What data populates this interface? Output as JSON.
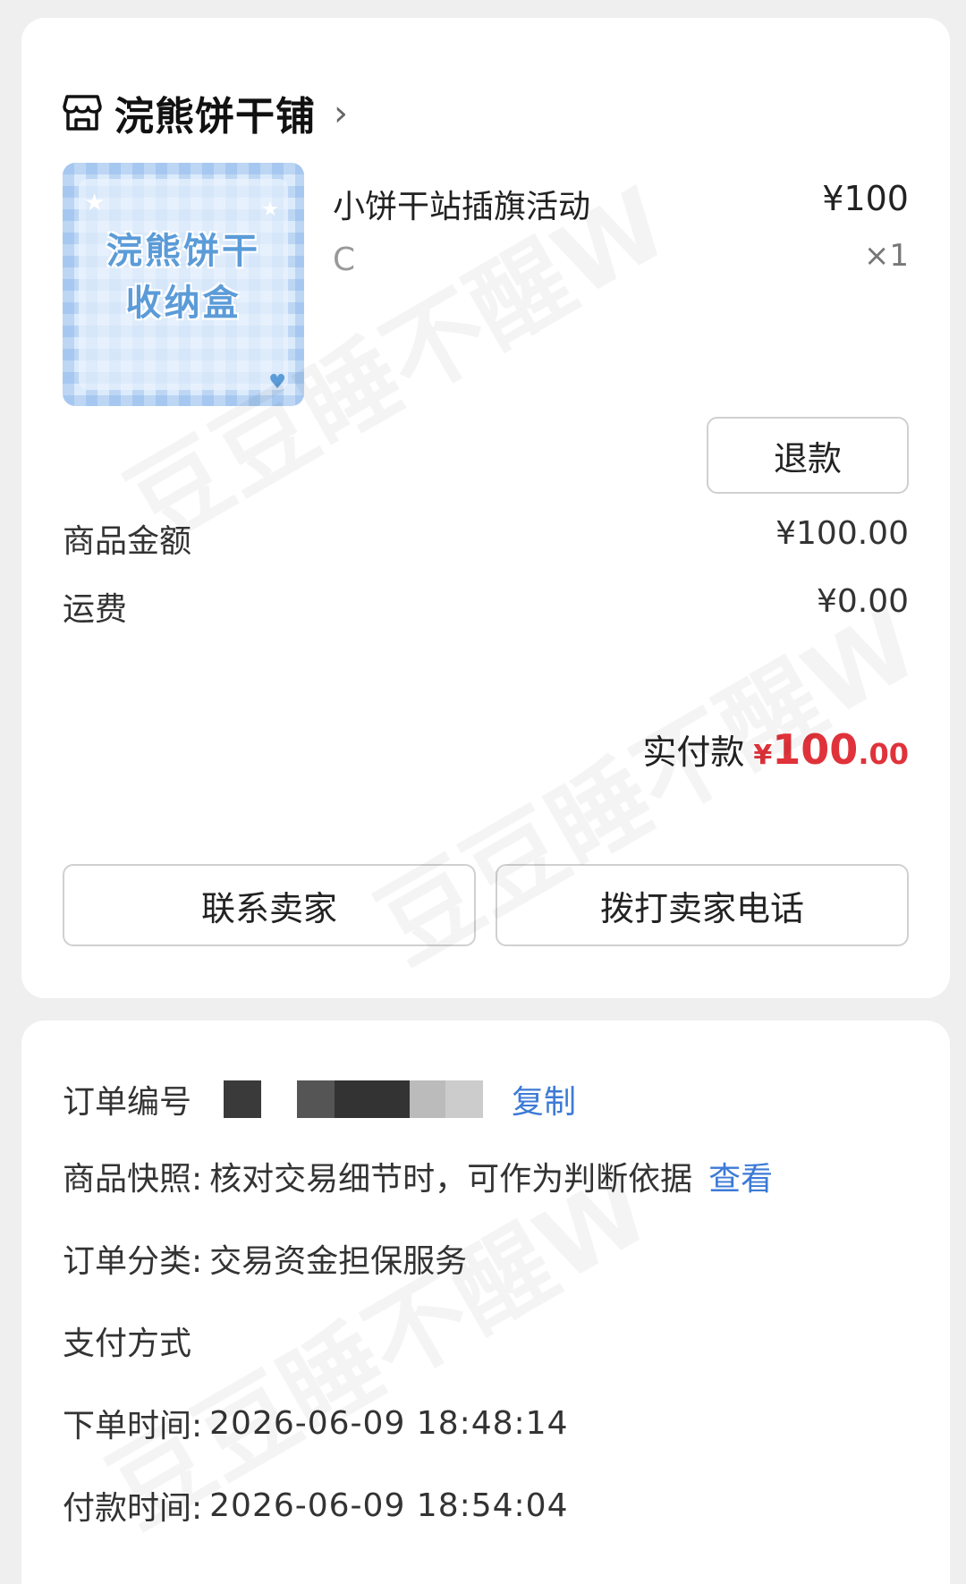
{
  "shop": {
    "name": "浣熊饼干铺",
    "chevron": "›"
  },
  "product": {
    "thumb_title_line1": "浣熊饼干",
    "thumb_title_line2": "收纳盒",
    "name": "小饼干站插旗活动",
    "spec": "C",
    "price": "¥100",
    "qty": "×1",
    "refund_label": "退款"
  },
  "amounts": {
    "goods_label": "商品金额",
    "goods_value": "¥100.00",
    "shipping_label": "运费",
    "shipping_value": "¥0.00",
    "paid_label": "实付款",
    "paid_symbol": "¥",
    "paid_integer": "100",
    "paid_decimal": ".00"
  },
  "actions": {
    "contact_seller": "联系卖家",
    "call_seller": "拨打卖家电话"
  },
  "info": {
    "order_no_label": "订单编号",
    "order_copy": "复制",
    "snapshot_label": "商品快照:",
    "snapshot_value": "核对交易细节时，可作为判断依据",
    "snapshot_link": "查看",
    "category_label": "订单分类:",
    "category_value": "交易资金担保服务",
    "payment_label": "支付方式",
    "order_time_label": "下单时间:",
    "order_time_value": "2026-06-09 18:48:14",
    "pay_time_label": "付款时间:",
    "pay_time_value": "2026-06-09 18:54:04"
  },
  "watermark": "豆豆睡不醒W",
  "colors": {
    "accent_red": "#e0323a",
    "link_blue": "#3d7ad6",
    "background": "#efefef"
  }
}
